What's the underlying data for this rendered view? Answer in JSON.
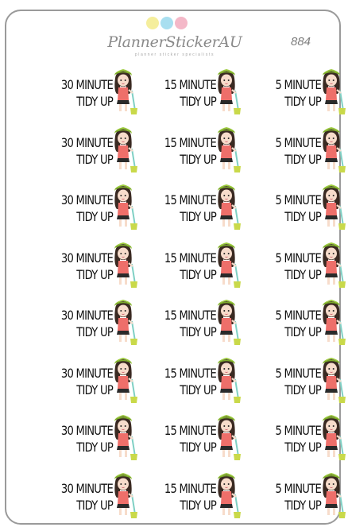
{
  "brand": {
    "name": "PlannerStickerAU",
    "tagline": "planner sticker specialists",
    "code": "884",
    "dot_colors": [
      "#f5ee9c",
      "#a9dff0",
      "#f4b8c8"
    ]
  },
  "colors": {
    "hair": "#3a2a22",
    "hat": "#9ccc3c",
    "hat_dark": "#7aa82a",
    "skin": "#f7dccb",
    "shirt": "#ee6f6a",
    "skirt": "#2a2a2a",
    "mop": "#7fd0c4",
    "bucket": "#c9d94a"
  },
  "rows": [
    [
      {
        "line1": "30 MINUTE",
        "line2": "TIDY UP"
      },
      {
        "line1": "15 MINUTE",
        "line2": "TIDY UP"
      },
      {
        "line1": "5 MINUTE",
        "line2": "TIDY UP"
      }
    ],
    [
      {
        "line1": "30 MINUTE",
        "line2": "TIDY UP"
      },
      {
        "line1": "15 MINUTE",
        "line2": "TIDY UP"
      },
      {
        "line1": "5 MINUTE",
        "line2": "TIDY UP"
      }
    ],
    [
      {
        "line1": "30 MINUTE",
        "line2": "TIDY UP"
      },
      {
        "line1": "15 MINUTE",
        "line2": "TIDY UP"
      },
      {
        "line1": "5 MINUTE",
        "line2": "TIDY UP"
      }
    ],
    [
      {
        "line1": "30 MINUTE",
        "line2": "TIDY UP"
      },
      {
        "line1": "15 MINUTE",
        "line2": "TIDY UP"
      },
      {
        "line1": "5 MINUTE",
        "line2": "TIDY UP"
      }
    ],
    [
      {
        "line1": "30 MINUTE",
        "line2": "TIDY UP"
      },
      {
        "line1": "15 MINUTE",
        "line2": "TIDY UP"
      },
      {
        "line1": "5 MINUTE",
        "line2": "TIDY UP"
      }
    ],
    [
      {
        "line1": "30 MINUTE",
        "line2": "TIDY UP"
      },
      {
        "line1": "15 MINUTE",
        "line2": "TIDY UP"
      },
      {
        "line1": "5 MINUTE",
        "line2": "TIDY UP"
      }
    ],
    [
      {
        "line1": "30 MINUTE",
        "line2": "TIDY UP"
      },
      {
        "line1": "15 MINUTE",
        "line2": "TIDY UP"
      },
      {
        "line1": "5 MINUTE",
        "line2": "TIDY UP"
      }
    ],
    [
      {
        "line1": "30 MINUTE",
        "line2": "TIDY UP"
      },
      {
        "line1": "15 MINUTE",
        "line2": "TIDY UP"
      },
      {
        "line1": "5 MINUTE",
        "line2": "TIDY UP"
      }
    ]
  ]
}
